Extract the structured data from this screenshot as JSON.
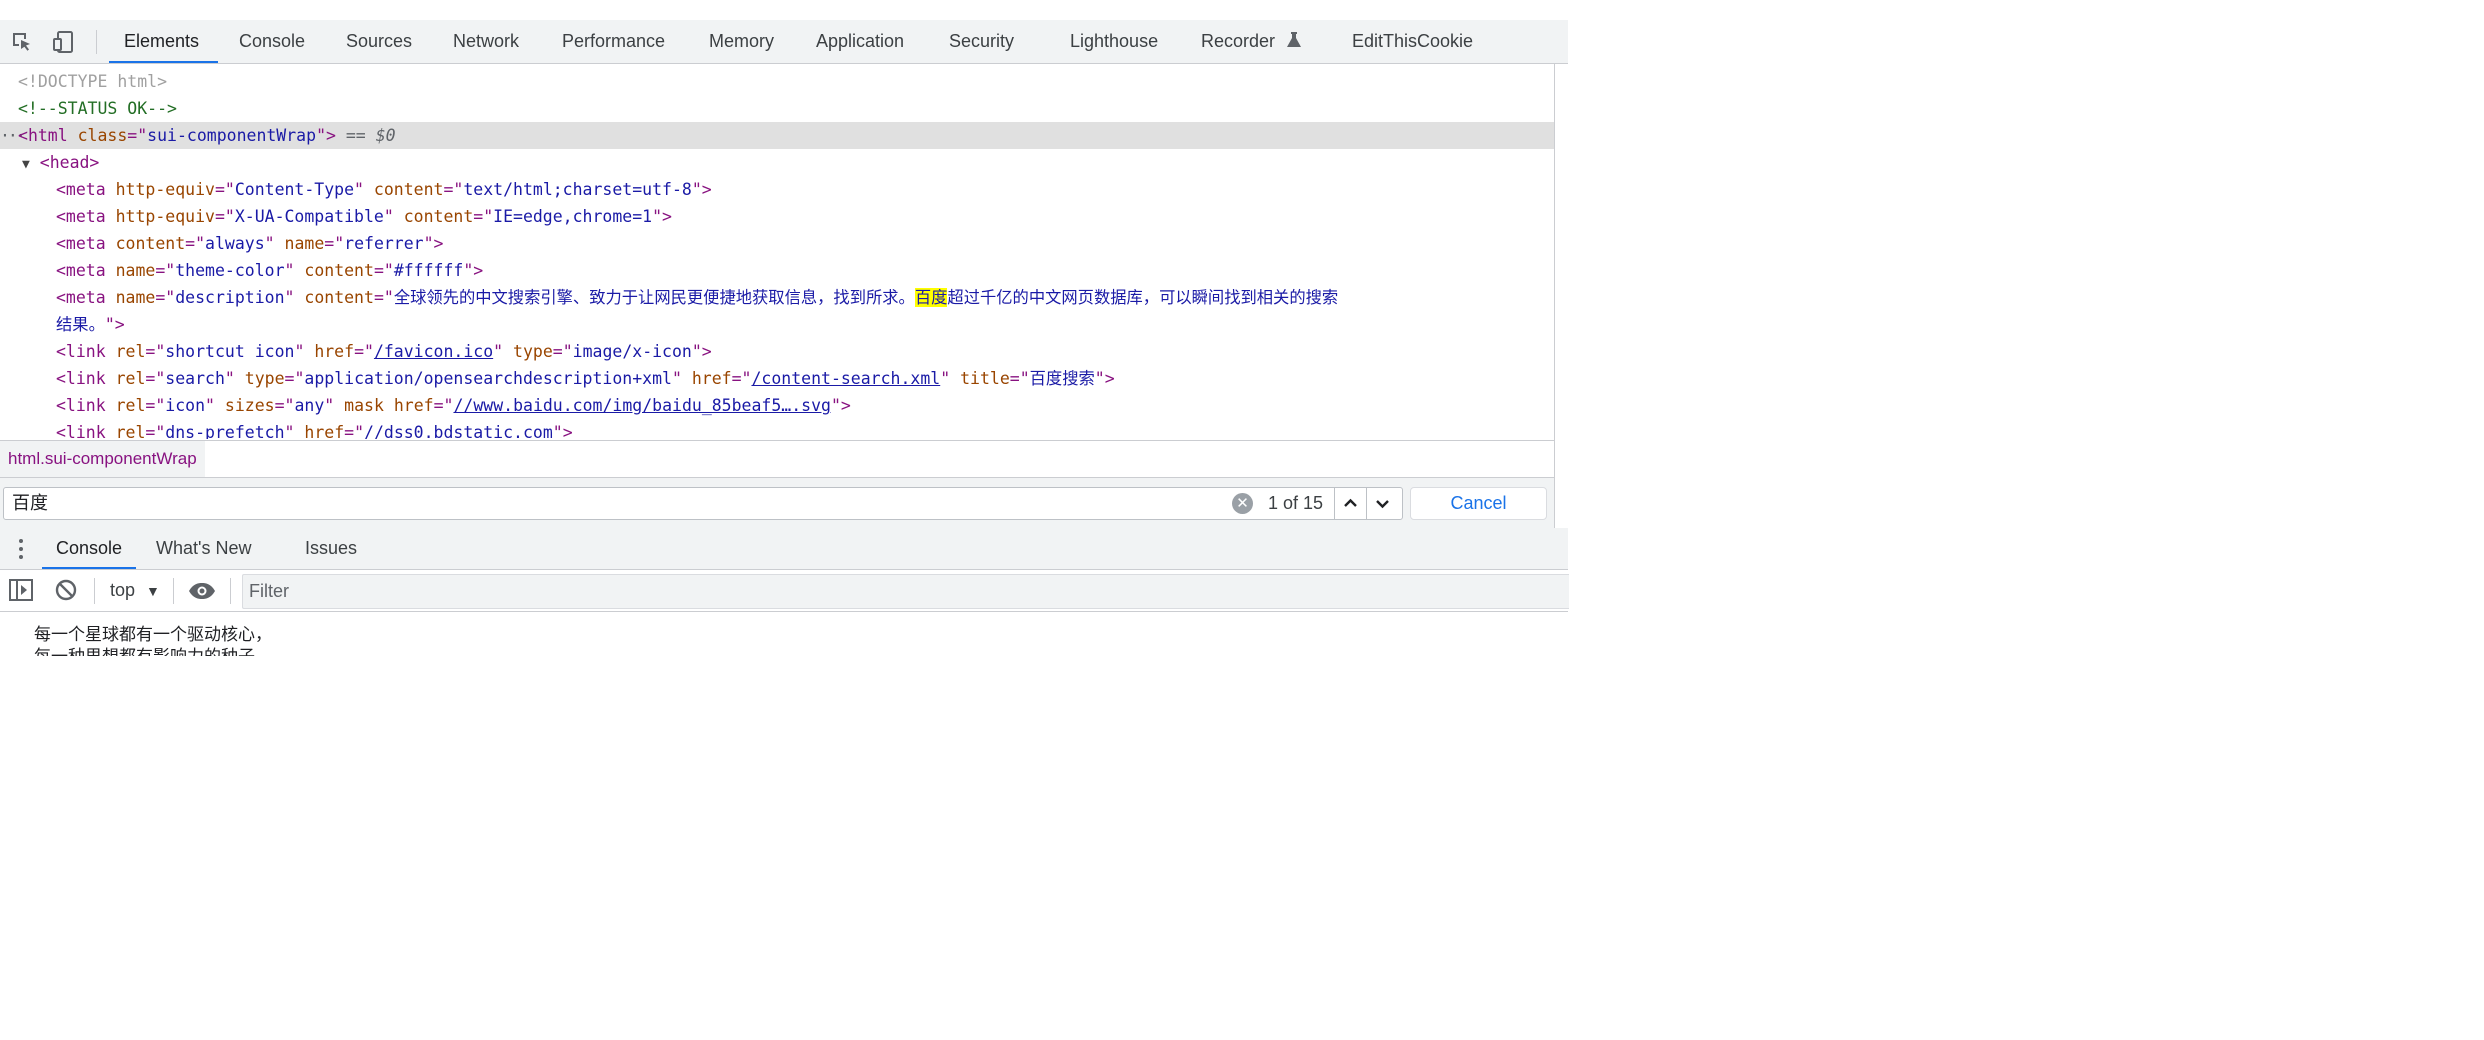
{
  "toolbar": {
    "tabs": [
      "Elements",
      "Console",
      "Sources",
      "Network",
      "Performance",
      "Memory",
      "Application",
      "Security",
      "Lighthouse",
      "Recorder",
      "EditThisCookie"
    ],
    "active_tab": "Elements",
    "icons": [
      "inspect-element-icon",
      "device-toolbar-icon",
      "flask-icon"
    ]
  },
  "dom": {
    "doctype": "<!DOCTYPE html>",
    "comment": "<!--STATUS OK-->",
    "html_tag": "html",
    "html_class_attr": "class",
    "html_class_value": "sui-componentWrap",
    "selected_marker": "== $0",
    "head_tag": "<head>",
    "meta1": {
      "a1": "http-equiv",
      "v1": "Content-Type",
      "a2": "content",
      "v2": "text/html;charset=utf-8"
    },
    "meta2": {
      "a1": "http-equiv",
      "v1": "X-UA-Compatible",
      "a2": "content",
      "v2": "IE=edge,chrome=1"
    },
    "meta3": {
      "a1": "content",
      "v1": "always",
      "a2": "name",
      "v2": "referrer"
    },
    "meta4": {
      "a1": "name",
      "v1": "theme-color",
      "a2": "content",
      "v2": "#ffffff"
    },
    "meta5": {
      "a1": "name",
      "v1": "description",
      "a2": "content",
      "v2_before": "全球领先的中文搜索引擎、致力于让网民更便捷地获取信息，找到所求。",
      "v2_match": "百度",
      "v2_after": "超过千亿的中文网页数据库，可以瞬间找到相关的搜索",
      "v2_wrap": "结果。"
    },
    "link1": {
      "a1": "rel",
      "v1": "shortcut icon",
      "a2": "href",
      "v2": "/favicon.ico",
      "a3": "type",
      "v3": "image/x-icon"
    },
    "link2": {
      "a1": "rel",
      "v1": "search",
      "a2": "type",
      "v2": "application/opensearchdescription+xml",
      "a3": "href",
      "v3": "/content-search.xml",
      "a4": "title",
      "v4": "百度搜索"
    },
    "link3": {
      "a1": "rel",
      "v1": "icon",
      "a2": "sizes",
      "v2": "any",
      "a3": "mask",
      "a4": "href",
      "v4": "//www.baidu.com/img/baidu_85beaf5….svg"
    },
    "link4": {
      "a1": "rel",
      "v1": "dns-prefetch",
      "a2": "href",
      "v2": "//dss0.bdstatic.com"
    }
  },
  "breadcrumb": "html.sui-componentWrap",
  "search": {
    "query": "百度",
    "match_count": "1 of 15",
    "cancel_label": "Cancel"
  },
  "drawer": {
    "tabs": [
      "Console",
      "What's New",
      "Issues"
    ],
    "active_tab": "Console"
  },
  "console": {
    "context": "top",
    "filter_placeholder": "Filter",
    "lines": [
      "每一个星球都有一个驱动核心，",
      "每一种思想都有影响力的种子。"
    ]
  },
  "colors": {
    "tag": "#881280",
    "attr_name": "#994500",
    "attr_value": "#1a1aa6",
    "comment": "#236e25",
    "accent": "#1a73e8",
    "search_highlight": "#ffff00"
  }
}
